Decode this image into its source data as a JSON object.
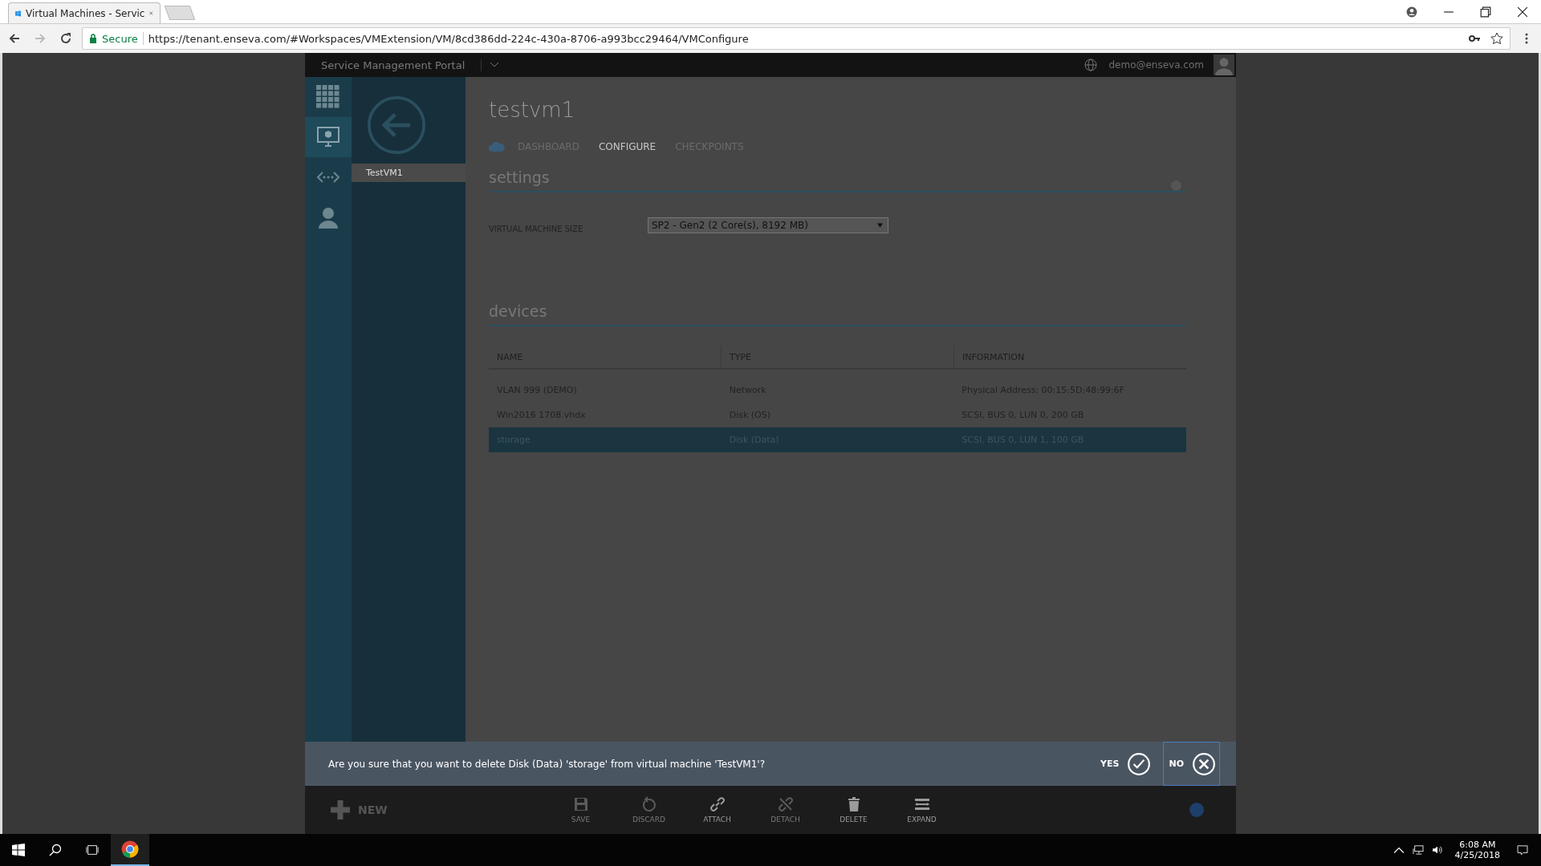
{
  "browser": {
    "tab_title": "Virtual Machines - Servic",
    "secure_label": "Secure",
    "url": "https://tenant.enseva.com/#Workspaces/VMExtension/VM/8cd386dd-224c-430a-8706-a993bcc29464/VMConfigure"
  },
  "portal": {
    "title": "Service Management Portal",
    "user": "demo@enseva.com"
  },
  "nav": [
    {
      "kind": "grid",
      "selected": false
    },
    {
      "kind": "monitor",
      "selected": true
    },
    {
      "kind": "network",
      "selected": false
    },
    {
      "kind": "user",
      "selected": false
    }
  ],
  "side_items": [
    {
      "label": "TestVM1",
      "selected": true
    }
  ],
  "page_title": "testvm1",
  "tabs": [
    {
      "label": "DASHBOARD",
      "selected": false
    },
    {
      "label": "CONFIGURE",
      "selected": true
    },
    {
      "label": "CHECKPOINTS",
      "selected": false
    }
  ],
  "settings": {
    "heading": "settings",
    "field_label": "VIRTUAL MACHINE SIZE",
    "size_value": "SP2 - Gen2 (2 Core(s), 8192 MB)"
  },
  "devices": {
    "heading": "devices",
    "columns": [
      "NAME",
      "TYPE",
      "INFORMATION"
    ],
    "rows": [
      {
        "cells": [
          "VLAN 999 (DEMO)",
          "Network",
          "Physical Address: 00:15:5D:48:99:6F"
        ],
        "selected": false
      },
      {
        "cells": [
          "Win2016 1708.vhdx",
          "Disk (OS)",
          "SCSI, BUS 0, LUN 0, 200 GB"
        ],
        "selected": false
      },
      {
        "cells": [
          "storage",
          "Disk (Data)",
          "SCSI, BUS 0, LUN 1, 100 GB"
        ],
        "selected": true
      }
    ]
  },
  "confirm": {
    "message": "Are you sure that you want to delete Disk (Data) 'storage' from virtual machine 'TestVM1'?",
    "yes": "YES",
    "no": "NO"
  },
  "toolbar": {
    "new": "NEW",
    "actions": [
      {
        "kind": "save",
        "label": "SAVE",
        "disabled": true
      },
      {
        "kind": "discard",
        "label": "DISCARD",
        "disabled": true
      },
      {
        "kind": "attach",
        "label": "ATTACH",
        "disabled": false
      },
      {
        "kind": "detach",
        "label": "DETACH",
        "disabled": true
      },
      {
        "kind": "delete",
        "label": "DELETE",
        "disabled": false
      },
      {
        "kind": "expand",
        "label": "EXPAND",
        "disabled": false
      }
    ]
  },
  "taskbar": {
    "time": "6:08 AM",
    "date": "4/25/2018"
  }
}
